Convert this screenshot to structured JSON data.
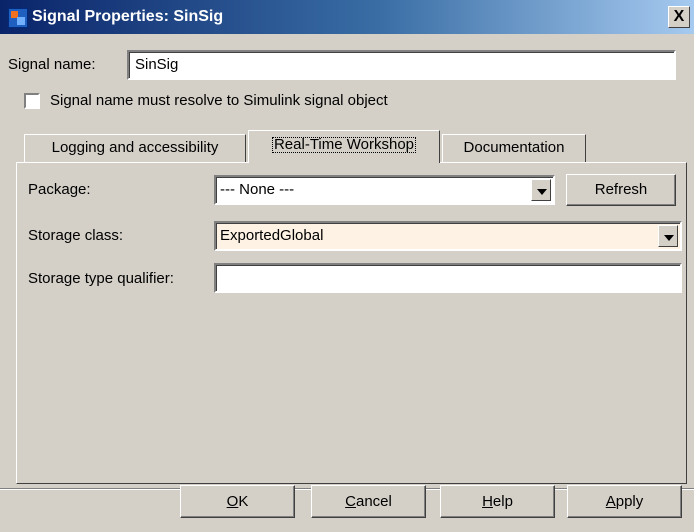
{
  "window": {
    "title": "Signal Properties: SinSig",
    "close_glyph": "X"
  },
  "signal_name": {
    "label": "Signal name:",
    "value": "SinSig"
  },
  "resolve_checkbox": {
    "label": "Signal name must resolve to Simulink signal object",
    "checked": false
  },
  "tabs": [
    {
      "label": "Logging and accessibility"
    },
    {
      "label": "Real-Time Workshop"
    },
    {
      "label": "Documentation"
    }
  ],
  "rtw": {
    "package_label": "Package:",
    "package_value": "--- None ---",
    "refresh_label": "Refresh",
    "storage_class_label": "Storage class:",
    "storage_class_value": "ExportedGlobal",
    "storage_type_qualifier_label": "Storage type qualifier:",
    "storage_type_qualifier_value": ""
  },
  "buttons": {
    "ok": {
      "mnemonic": "O",
      "rest": "K"
    },
    "cancel": {
      "mnemonic": "C",
      "rest": "ancel"
    },
    "help": {
      "mnemonic": "H",
      "rest": "elp"
    },
    "apply": {
      "mnemonic": "A",
      "rest": "pply"
    }
  },
  "colors": {
    "window_bg": "#d4d0c8",
    "highlighted_field_bg": "#fdf2e3",
    "titlebar_left": "#0a246a"
  }
}
